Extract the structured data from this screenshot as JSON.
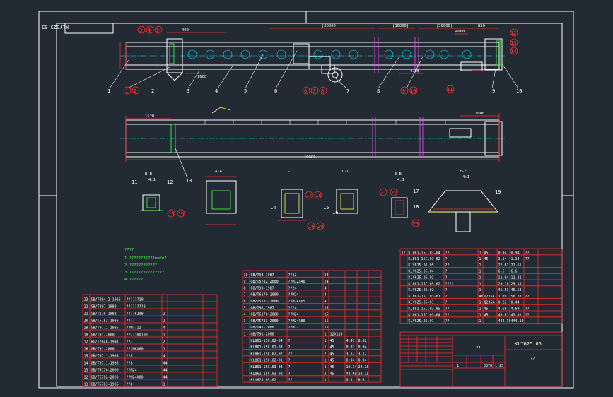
{
  "drawing_code_rotated": "KLY625.05",
  "drawing_code": "KLY625.05",
  "title_placeholder": "??",
  "title_placeholder_2": "??",
  "callouts_top": [
    "1",
    "2",
    "3",
    "4",
    "5",
    "6",
    "7",
    "8",
    "9",
    "10"
  ],
  "callouts_circle_top": [
    "3",
    "4",
    "5"
  ],
  "callouts_circle_left": [
    "1",
    "2"
  ],
  "callouts_circle_mid": [
    "6",
    "7",
    "8"
  ],
  "callouts_circle_right": [
    "9",
    "10"
  ],
  "callouts_circle_far": [
    "11"
  ],
  "callouts_circle_rightcol": [
    "12",
    "13",
    "14"
  ],
  "dims_top": [
    "400",
    "|30000|",
    "|30000|",
    "|30000|",
    "850",
    "4000",
    "4705",
    "1600"
  ],
  "dims_plan": [
    "1120",
    "10600",
    "1000",
    "13"
  ],
  "section_labels": [
    "B-B",
    "A-A",
    "C-C",
    "D-D",
    "E-E",
    "F-F"
  ],
  "section_scales": [
    "4:1",
    "",
    "",
    "",
    "4:1",
    "4:1"
  ],
  "section_callouts": [
    "11",
    "12",
    "15",
    "16",
    "14",
    "17",
    "18",
    "19",
    "20",
    "15",
    "16",
    "21",
    "22",
    "17",
    "18",
    "23",
    "19"
  ],
  "notes_title": "????",
  "notes": [
    "1.??????????1mm/m?",
    "2.????????????",
    "3.???????????????",
    "4.??????"
  ],
  "bom_left": [
    [
      "23",
      "GB/T894.2-1986",
      "??????10",
      ""
    ],
    [
      "22",
      "GB/T897-1988",
      "????????8",
      ""
    ],
    [
      "21",
      "GB/T276-1982",
      "????6208",
      "2"
    ],
    [
      "20",
      "GB/T5783-1986",
      "????",
      "2"
    ],
    [
      "19",
      "GB/T97.1-1985",
      "??M??12",
      "4"
    ],
    [
      "18",
      "GB/T91-2000",
      "????10X100",
      "1"
    ],
    [
      "17",
      "HG/T2048-1991",
      "???",
      "2"
    ],
    [
      "16",
      "GB/T91-2000",
      "???M6X60",
      "1"
    ],
    [
      "15",
      "GB/T97.1-1985",
      "??8",
      "4"
    ],
    [
      "14",
      "GB/T97.1-1985",
      "??8",
      "44"
    ],
    [
      "13",
      "GB/T6170-2000",
      "??M24",
      "44"
    ],
    [
      "12",
      "GB/T5782-2000",
      "??M24X80",
      "44"
    ],
    [
      "11",
      "GB/T5783-1986",
      "??8",
      "1"
    ]
  ],
  "bom_mid": [
    [
      "10",
      "GB/T93-1987",
      "??12",
      "24"
    ],
    [
      "9",
      "GB/T5782-2000",
      "??M12X40",
      "24"
    ],
    [
      "8",
      "GB/T93-1987",
      "??24",
      "4"
    ],
    [
      "7",
      "GB/T6170-2000",
      "??M24",
      "4"
    ],
    [
      "6",
      "GB/T5783-2000",
      "??M24X65",
      "4"
    ],
    [
      "5",
      "GB/T93-1987",
      "??24",
      "15"
    ],
    [
      "4",
      "GB/T6170-2000",
      "??M24",
      "15"
    ],
    [
      "3",
      "GB/T5783-2000",
      "??M24X80",
      "15"
    ],
    [
      "2",
      "GB/T41-2000",
      "??M12",
      "15"
    ],
    [
      "1",
      "GB/T91-2000",
      "",
      "1",
      "12X110",
      "",
      ""
    ],
    [
      "",
      "KL861-15C.02-04",
      "?",
      "1",
      "45",
      "4.41",
      "8.82"
    ],
    [
      "",
      "KL861-15C.02-03",
      "?",
      "1",
      "45",
      "0.02",
      "0.04"
    ],
    [
      "",
      "KL861-15C.02-02",
      "??",
      "2",
      "45",
      "3.12",
      "3.12"
    ],
    [
      "",
      "KL861-15C.02-01",
      "?",
      "1",
      "45",
      "0.94",
      "0.94"
    ],
    [
      "",
      "KL861-15C.03-03",
      "?",
      "1",
      "45",
      "12.14",
      "24.28"
    ],
    [
      "",
      "KL861-15C.03-02",
      "?",
      "2",
      "45",
      "48.69",
      "18.15"
    ],
    [
      "",
      "KLY625.05-02",
      "??",
      "1",
      "",
      "0.3",
      "0.6"
    ]
  ],
  "bom_right": [
    [
      "12",
      "KL861-15C.03-04",
      "??",
      "1",
      "45",
      "0.94",
      "0.94",
      "??"
    ],
    [
      "",
      "KL861-15C.03-02",
      "?",
      "1",
      "45",
      "1.14",
      "1.14",
      "??"
    ],
    [
      "",
      "KLY625.05.05",
      "??",
      "1",
      "",
      "22.61",
      "22.61",
      ""
    ],
    [
      "",
      "KLY625.05.04",
      "?",
      "1",
      "",
      "6.6",
      "6.6",
      ""
    ],
    [
      "",
      "KLY625.05.03",
      "?",
      "1",
      "",
      "11.94",
      "12.32",
      ""
    ],
    [
      "",
      "KL861-15C.05.02",
      "????",
      "1",
      "",
      "29.18",
      "29.18",
      ""
    ],
    [
      "",
      "KLY625.05.02",
      "?",
      "1",
      "",
      "46.53",
      "46.53",
      ""
    ],
    [
      "",
      "KL861-15C.03-01",
      "?",
      "46",
      "Q235A",
      "1.09",
      "50.28",
      "??"
    ],
    [
      "",
      "KLY625.05-01",
      "?",
      "1",
      "Q235A",
      "0.22",
      "0.44",
      ""
    ],
    [
      "",
      "KL861-15C.03.05",
      "??",
      "1",
      "45",
      "4.69",
      "4.69",
      "??"
    ],
    [
      "",
      "KL861-15C.03-04",
      "??",
      "1",
      "45",
      "43.81",
      "43.81",
      "??"
    ],
    [
      "",
      "KLY625.05.01",
      "??",
      "1",
      "",
      "444.19",
      "444.19",
      ""
    ]
  ],
  "bom_header_right": [
    "??",
    "??",
    "??",
    "??",
    "??",
    "??",
    "??",
    "??"
  ],
  "title_block": {
    "scale": "1:25",
    "mass": "3370",
    "sheet": "1",
    "field_a": "??",
    "field_b": "??"
  }
}
